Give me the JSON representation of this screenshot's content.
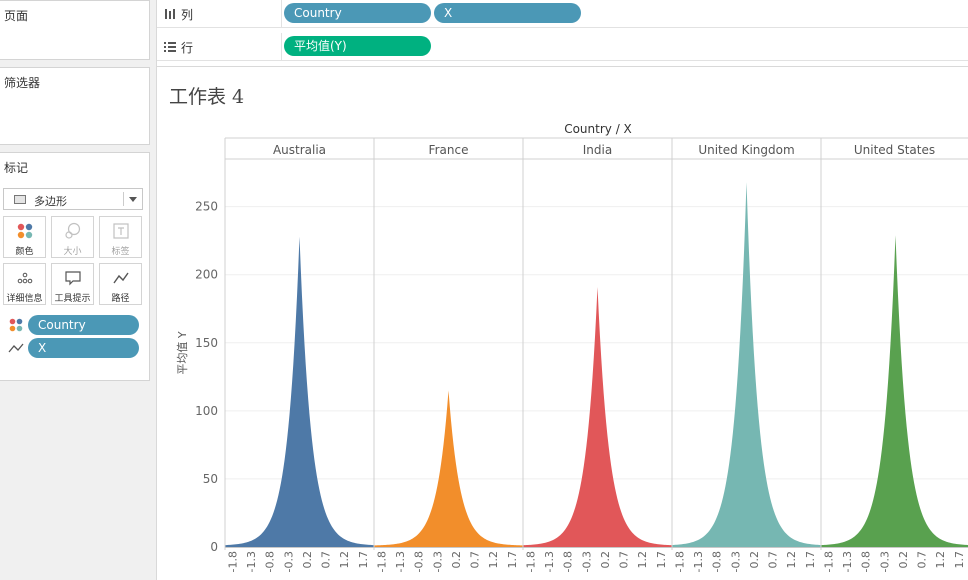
{
  "left_panel": {
    "pages_title": "页面",
    "filters_title": "筛选器",
    "marks": {
      "title": "标记",
      "mark_type": "多边形",
      "buttons": [
        {
          "label": "颜色",
          "icon": "color-dots-icon",
          "enabled": true
        },
        {
          "label": "大小",
          "icon": "size-circles-icon",
          "enabled": false
        },
        {
          "label": "标签",
          "icon": "label-t-icon",
          "enabled": false
        },
        {
          "label": "详细信息",
          "icon": "detail-dots-icon",
          "enabled": true
        },
        {
          "label": "工具提示",
          "icon": "tooltip-bubble-icon",
          "enabled": true
        },
        {
          "label": "路径",
          "icon": "path-line-icon",
          "enabled": true
        }
      ],
      "pills": [
        {
          "label": "Country",
          "icon": "color-dots-icon"
        },
        {
          "label": "X",
          "icon": "path-line-icon"
        }
      ]
    }
  },
  "shelves": {
    "columns": {
      "label": "列",
      "icon": "columns-icon",
      "pills": [
        "Country",
        "X"
      ]
    },
    "rows": {
      "label": "行",
      "icon": "rows-icon",
      "pills": [
        "平均值(Y)"
      ]
    }
  },
  "worksheet": {
    "title": "工作表 4"
  },
  "colors": {
    "pill_blue": "#4b98b6",
    "pill_green": "#00b180"
  },
  "chart_data": {
    "type": "area",
    "header": "Country / X",
    "ylabel": "平均值 Y",
    "ylim": [
      0,
      285
    ],
    "y_ticks": [
      0,
      50,
      100,
      150,
      200,
      250
    ],
    "x_range": [
      -2,
      2
    ],
    "x_tick_labels": [
      "-1.8",
      "-1.3",
      "-0.8",
      "-0.3",
      "0.2",
      "0.7",
      "1.2",
      "1.7"
    ],
    "grid": true,
    "series": [
      {
        "name": "Australia",
        "color": "#4e79a7",
        "peak_x": 0.0,
        "peak": 228,
        "edge": 1
      },
      {
        "name": "France",
        "color": "#f28e2b",
        "peak_x": 0.0,
        "peak": 115,
        "edge": 1
      },
      {
        "name": "India",
        "color": "#e15759",
        "peak_x": 0.0,
        "peak": 191,
        "edge": 1
      },
      {
        "name": "United Kingdom",
        "color": "#76b7b2",
        "peak_x": 0.0,
        "peak": 268,
        "edge": 1
      },
      {
        "name": "United States",
        "color": "#59a14f",
        "peak_x": 0.0,
        "peak": 229,
        "edge": 1
      }
    ]
  }
}
